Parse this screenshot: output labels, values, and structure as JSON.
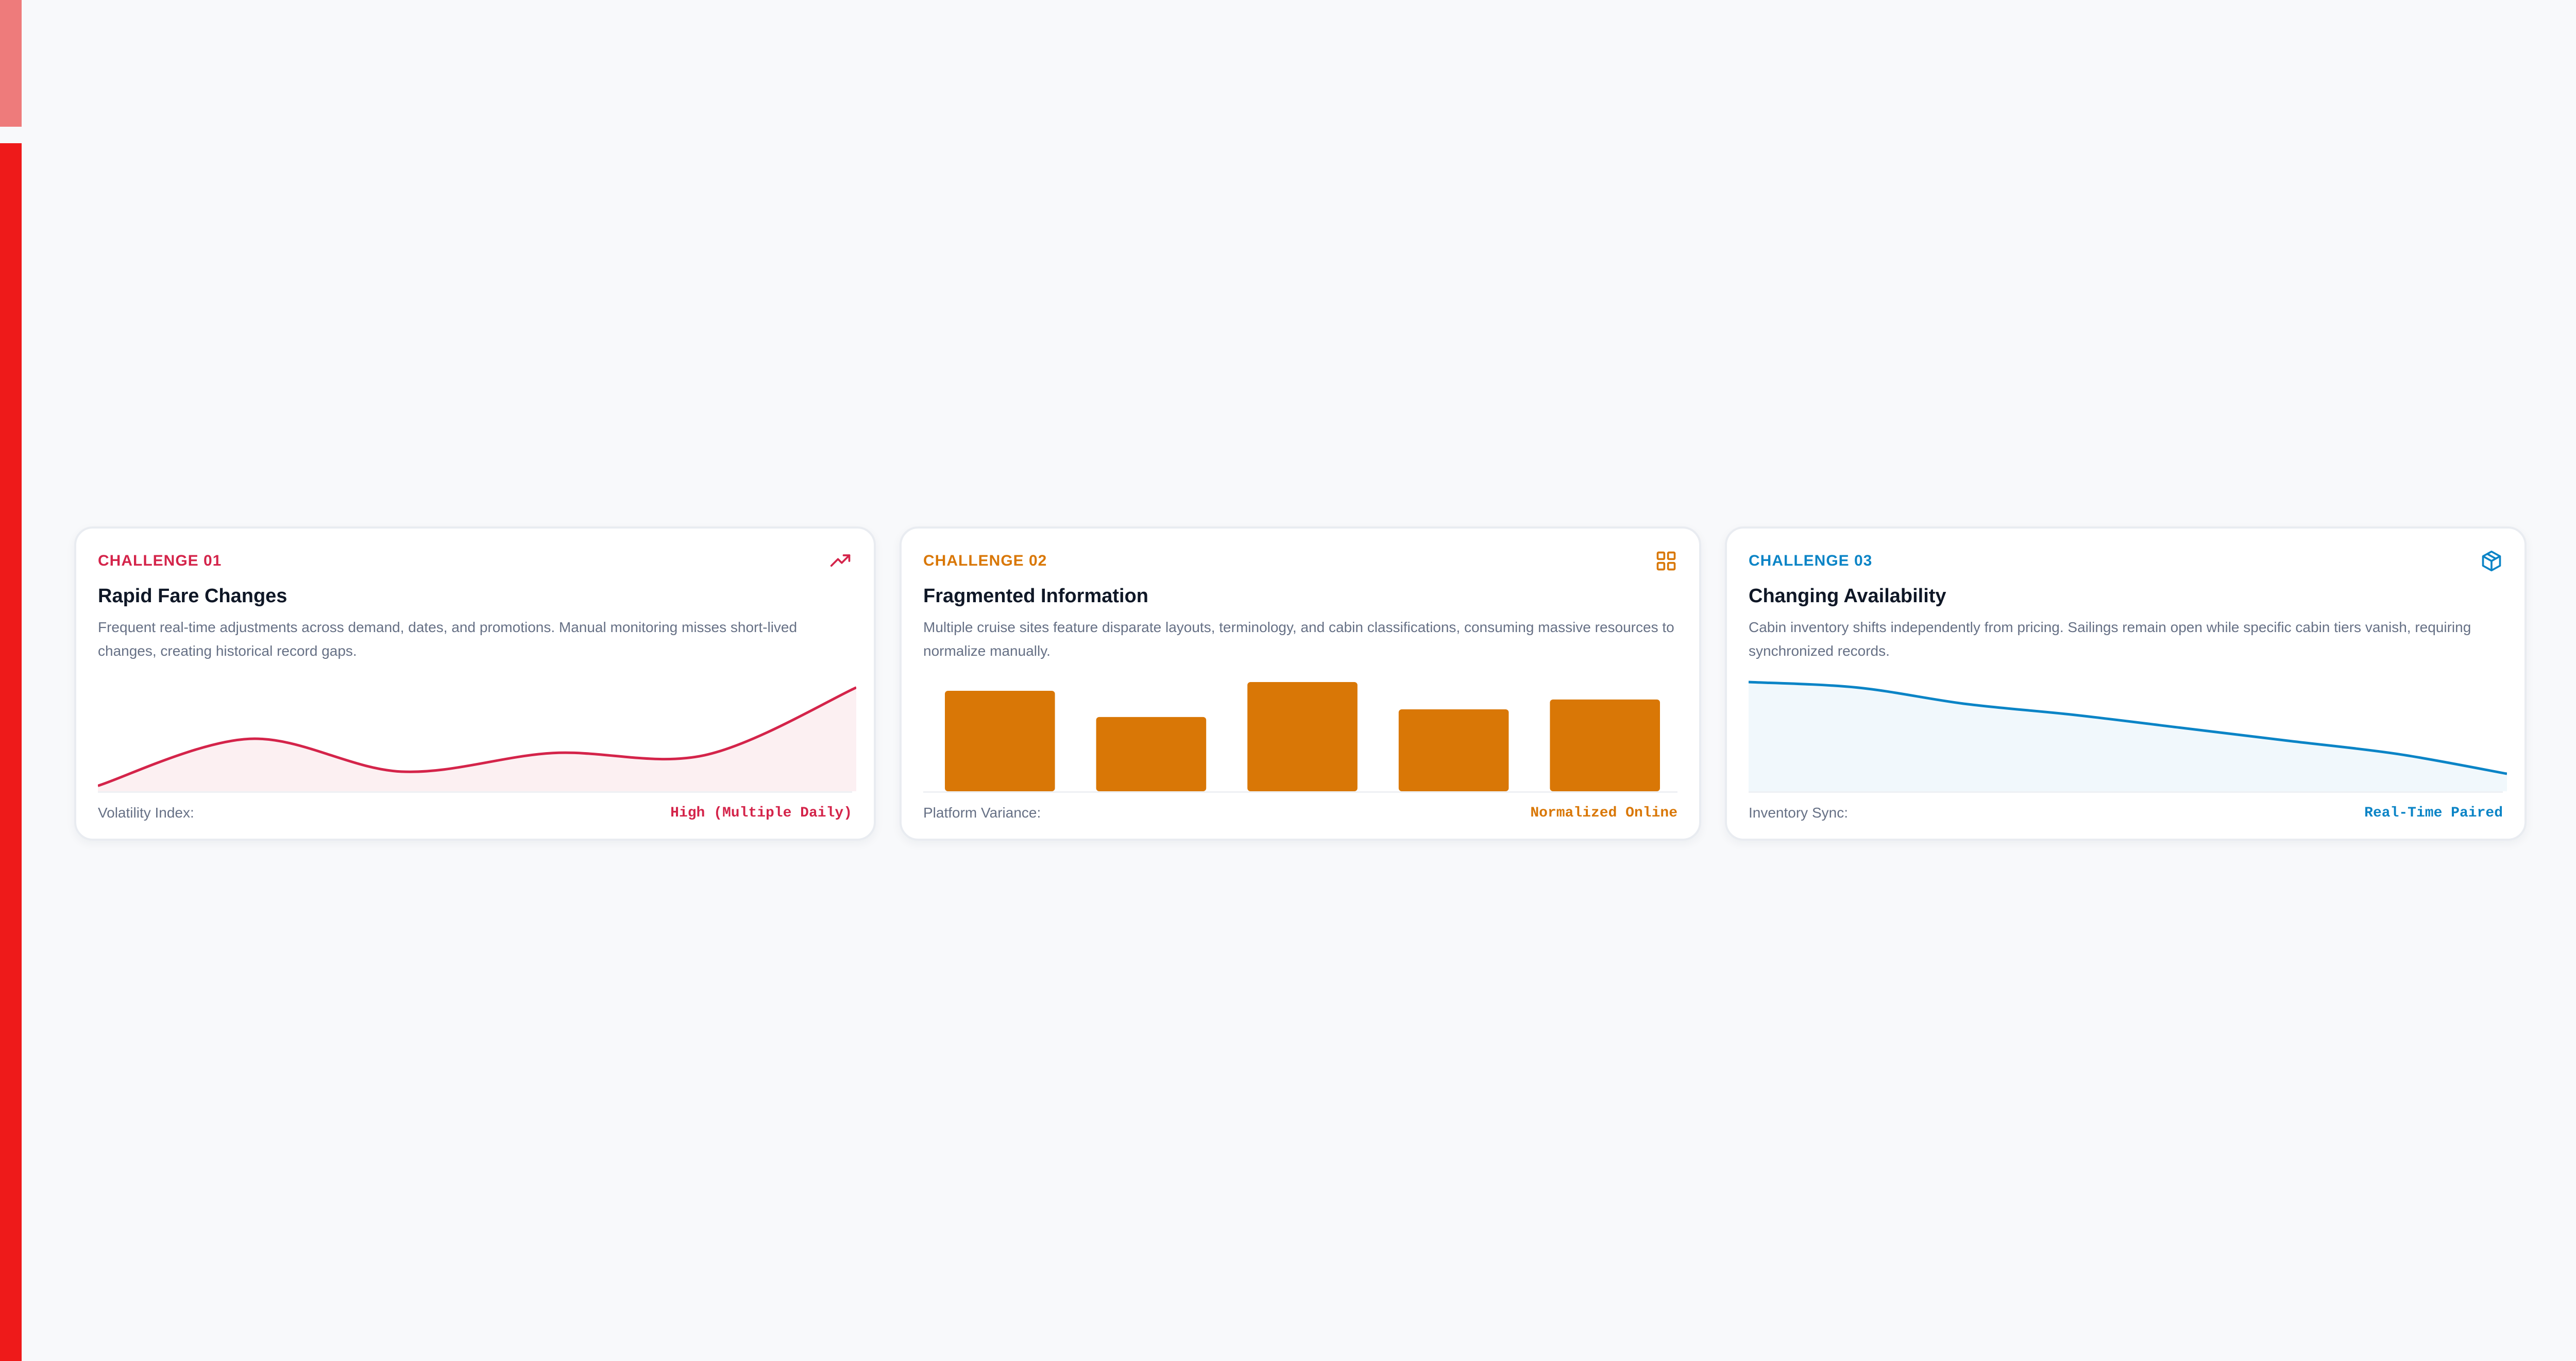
{
  "colors": {
    "accent_red": "#d4244a",
    "accent_orange": "#d97706",
    "accent_blue": "#0b84c6",
    "left_bar": "#ee1a1a",
    "left_bar_light": "#ee7b7b"
  },
  "cards": [
    {
      "kicker": "CHALLENGE 01",
      "icon": "trend-up-icon",
      "title": "Rapid Fare Changes",
      "description": "Frequent real-time adjustments across demand, dates, and promotions. Manual monitoring misses short-lived changes, creating historical record gaps.",
      "footer_label": "Volatility Index:",
      "footer_value": "High (Multiple Daily)"
    },
    {
      "kicker": "CHALLENGE 02",
      "icon": "grid-icon",
      "title": "Fragmented Information",
      "description": "Multiple cruise sites feature disparate layouts, terminology, and cabin classifications, consuming massive resources to normalize manually.",
      "footer_label": "Platform Variance:",
      "footer_value": "Normalized Online"
    },
    {
      "kicker": "CHALLENGE 03",
      "icon": "box-icon",
      "title": "Changing Availability",
      "description": "Cabin inventory shifts independently from pricing. Sailings remain open while specific cabin tiers vanish, requiring synchronized records.",
      "footer_label": "Inventory Sync:",
      "footer_value": "Real-Time Paired"
    }
  ],
  "chart_data": [
    {
      "type": "area",
      "values": [
        5,
        48,
        18,
        35,
        33,
        95
      ],
      "ylim": [
        0,
        100
      ]
    },
    {
      "type": "bar",
      "values": [
        92,
        68,
        100,
        75,
        84
      ],
      "ylim": [
        0,
        100
      ]
    },
    {
      "type": "area",
      "values": [
        100,
        95,
        80,
        70,
        58,
        46,
        34,
        16
      ],
      "ylim": [
        0,
        100
      ]
    }
  ]
}
